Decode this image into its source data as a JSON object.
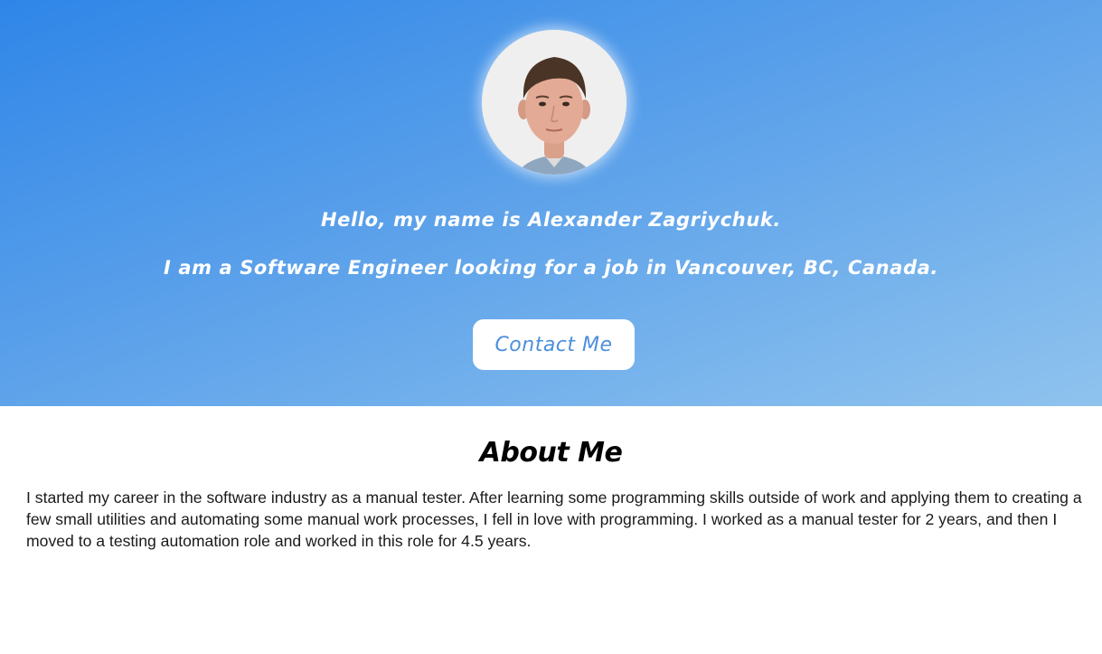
{
  "hero": {
    "avatar_alt": "Profile photo",
    "greeting": "Hello, my name is Alexander Zagriychuk.",
    "tagline": "I am a Software Engineer looking for a job in Vancouver, BC, Canada.",
    "contact_label": "Contact Me"
  },
  "about": {
    "title": "About Me",
    "text": "I started my career in the software industry as a manual tester. After learning some programming skills outside of work and applying them to creating a few small utilities and automating some manual work processes, I fell in love with programming. I worked as a manual tester for 2 years, and then I moved to a testing automation role and worked in this role for 4.5 years."
  },
  "colors": {
    "hero_start": "#2f86e8",
    "hero_end": "#8fc3ee",
    "button_text": "#4d8fdc"
  }
}
